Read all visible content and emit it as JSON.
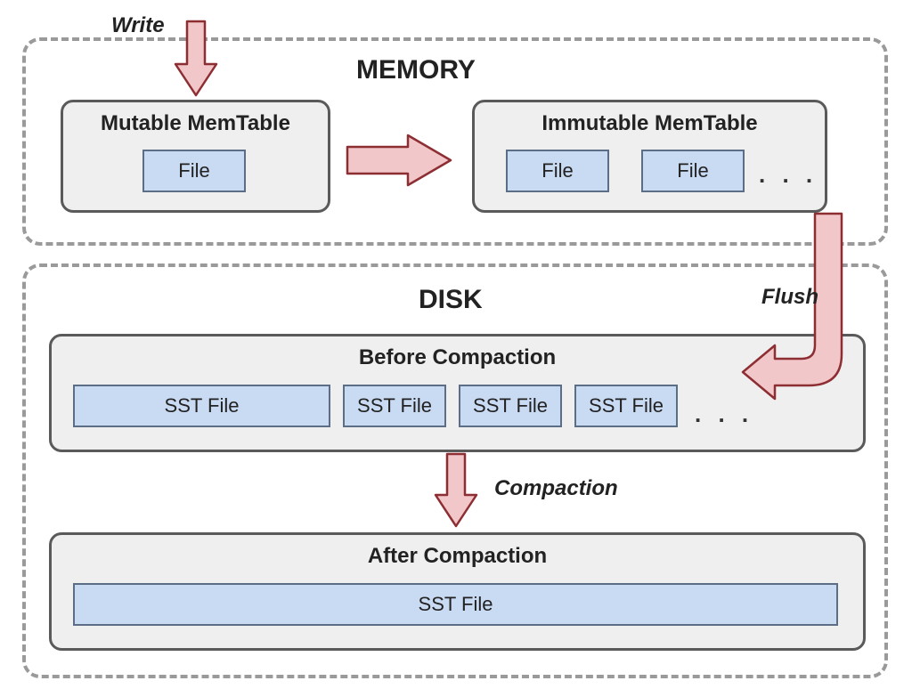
{
  "regions": {
    "memory": {
      "title": "MEMORY"
    },
    "disk": {
      "title": "DISK"
    }
  },
  "memory": {
    "mutable": {
      "title": "Mutable MemTable",
      "file": "File"
    },
    "immutable": {
      "title": "Immutable MemTable",
      "file1": "File",
      "file2": "File",
      "ellipsis": ". . ."
    }
  },
  "disk": {
    "before": {
      "title": "Before Compaction",
      "sst1": "SST File",
      "sst2": "SST File",
      "sst3": "SST File",
      "sst4": "SST File",
      "ellipsis": ". . ."
    },
    "after": {
      "title": "After Compaction",
      "sst": "SST File"
    }
  },
  "ops": {
    "write": "Write",
    "flush": "Flush",
    "compaction": "Compaction"
  }
}
